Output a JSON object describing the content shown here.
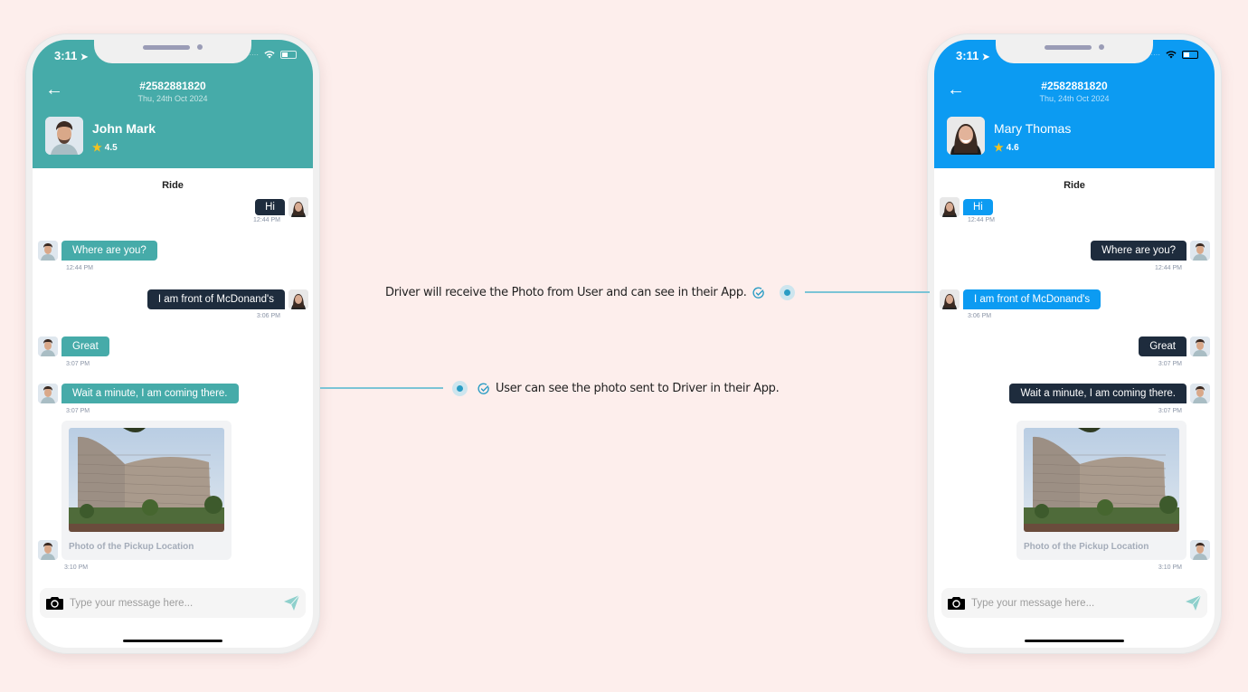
{
  "colors": {
    "background": "#fdeeec",
    "driver_theme": "#46aba9",
    "user_theme": "#0c9bf2",
    "dark_bubble": "#1e2c3d",
    "connector": "#7bc4d6",
    "accent_dot": "#2a9cc4"
  },
  "phones": [
    {
      "id": "driver-app",
      "theme": "#46aba9",
      "status_time": "3:11",
      "order_number": "#2582881820",
      "order_date": "Thu, 24th Oct 2024",
      "contact_name": "John Mark",
      "contact_rating": "4.5",
      "section_label": "Ride",
      "messages": [
        {
          "text": "Hi",
          "time": "12:44 PM",
          "direction": "outgoing"
        },
        {
          "text": "Where are you?",
          "time": "12:44 PM",
          "direction": "incoming"
        },
        {
          "text": "I am front of McDonand's",
          "time": "3:06 PM",
          "direction": "outgoing"
        },
        {
          "text": "Great",
          "time": "3:07 PM",
          "direction": "incoming"
        },
        {
          "text": "Wait a minute, I am coming there.",
          "time": "3:07 PM",
          "direction": "incoming"
        }
      ],
      "photo_message": {
        "caption": "Photo of the Pickup Location",
        "time": "3:10 PM",
        "direction": "incoming"
      },
      "composer_placeholder": "Type your message here..."
    },
    {
      "id": "user-app",
      "theme": "#0c9bf2",
      "status_time": "3:11",
      "order_number": "#2582881820",
      "order_date": "Thu, 24th Oct 2024",
      "contact_name": "Mary Thomas",
      "contact_rating": "4.6",
      "section_label": "Ride",
      "messages": [
        {
          "text": "Hi",
          "time": "12:44 PM",
          "direction": "incoming"
        },
        {
          "text": "Where are you?",
          "time": "12:44 PM",
          "direction": "outgoing"
        },
        {
          "text": "I am front of McDonand's",
          "time": "3:06 PM",
          "direction": "incoming"
        },
        {
          "text": "Great",
          "time": "3:07 PM",
          "direction": "outgoing"
        },
        {
          "text": "Wait a minute, I am coming there.",
          "time": "3:07 PM",
          "direction": "outgoing"
        }
      ],
      "photo_message": {
        "caption": "Photo of the Pickup Location",
        "time": "3:10 PM",
        "direction": "outgoing"
      },
      "composer_placeholder": "Type your message here..."
    }
  ],
  "annotations": {
    "driver_receives": "Driver will receive the Photo from User and can see in their App.",
    "user_sees": "User can see the photo sent to Driver in their App."
  }
}
